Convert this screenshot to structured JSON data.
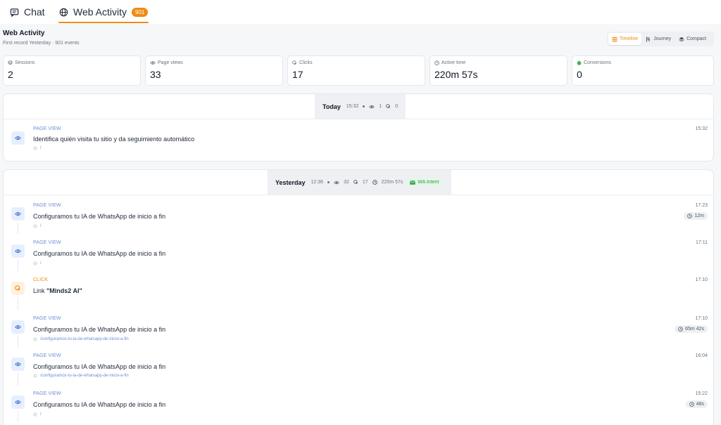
{
  "tabs": {
    "chat": {
      "label": "Chat"
    },
    "web": {
      "label": "Web Activity",
      "badge": "901"
    }
  },
  "header": {
    "title": "Web Activity",
    "subtitle": "First record Yesterday · 901 events"
  },
  "view_toggle": {
    "timeline": "Timeline",
    "journey": "Journey",
    "compact": "Compact",
    "active": "Timeline"
  },
  "stats": [
    {
      "label": "Sessions",
      "value": "2",
      "icon": "sessions-icon"
    },
    {
      "label": "Page views",
      "value": "33",
      "icon": "eye-icon"
    },
    {
      "label": "Clicks",
      "value": "17",
      "icon": "click-icon"
    },
    {
      "label": "Active time",
      "value": "220m 57s",
      "icon": "clock-icon"
    },
    {
      "label": "Conversions",
      "value": "0",
      "icon": "conversion-icon"
    }
  ],
  "groups": [
    {
      "day": "Today",
      "time": "15:32",
      "views": "1",
      "clicks": "0",
      "events": [
        {
          "type": "PAGE VIEW",
          "title": "Identifica quién visita tu sitio y da seguimiento automático",
          "url": "/",
          "time": "15:32"
        }
      ]
    },
    {
      "day": "Yesterday",
      "time": "12:36",
      "views": "32",
      "clicks": "17",
      "active": "220m 57s",
      "intent": "WA Intent",
      "events": [
        {
          "type": "PAGE VIEW",
          "title": "Configuramos tu IA de WhatsApp de inicio a fin",
          "url": "/",
          "time": "17:23",
          "duration": "12m"
        },
        {
          "type": "PAGE VIEW",
          "title": "Configuramos tu IA de WhatsApp de inicio a fin",
          "url": "/",
          "time": "17:11"
        },
        {
          "type": "CLICK",
          "title_prefix": "Link ",
          "title_strong": "\"Minds2 AI\"",
          "time": "17:10"
        },
        {
          "type": "PAGE VIEW",
          "title": "Configuramos tu IA de WhatsApp de inicio a fin",
          "url": "/configuramos-tu-ia-de-whatsapp-de-inicio-a-fin",
          "time": "17:10",
          "duration": "65m 42s"
        },
        {
          "type": "PAGE VIEW",
          "title": "Configuramos tu IA de WhatsApp de inicio a fin",
          "url": "/configuramos-tu-ia-de-whatsapp-de-inicio-a-fin",
          "time": "16:04"
        },
        {
          "type": "PAGE VIEW",
          "title": "Configuramos tu IA de WhatsApp de inicio a fin",
          "url": "/",
          "time": "15:22",
          "duration": "48s"
        }
      ]
    }
  ]
}
